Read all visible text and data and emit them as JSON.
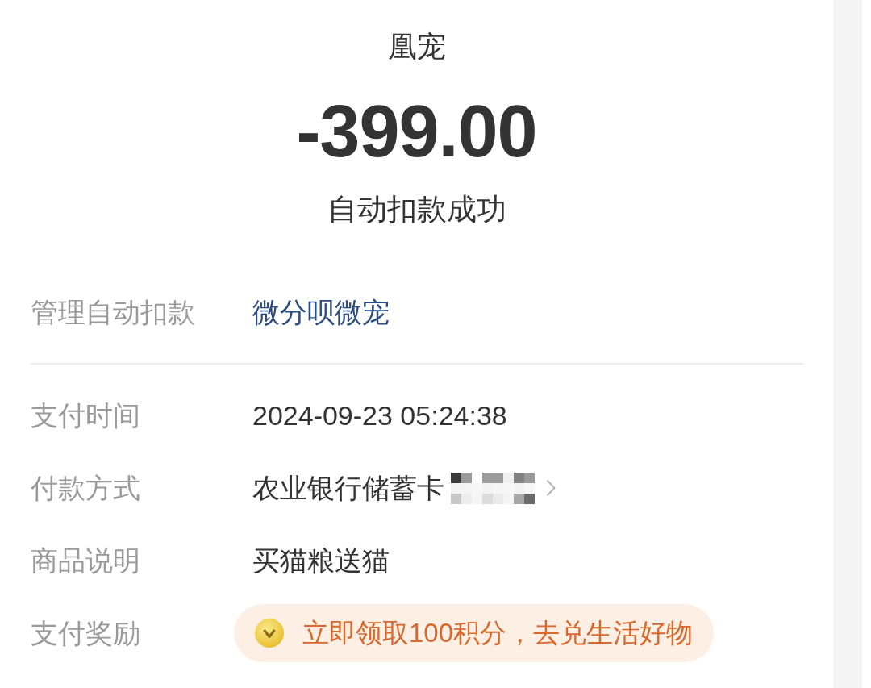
{
  "header": {
    "merchant": "凰宠",
    "amount": "-399.00",
    "status": "自动扣款成功"
  },
  "manage": {
    "label": "管理自动扣款",
    "value": "微分呗微宠"
  },
  "details": [
    {
      "kind": "text",
      "label": "支付时间",
      "value": "2024-09-23 05:24:38"
    },
    {
      "kind": "payment",
      "label": "付款方式",
      "value": "农业银行储蓄卡",
      "redacted": true
    },
    {
      "kind": "text",
      "label": "商品说明",
      "value": "买猫粮送猫"
    },
    {
      "kind": "reward",
      "label": "支付奖励",
      "value": "立即领取100积分，去兑生活好物"
    }
  ]
}
